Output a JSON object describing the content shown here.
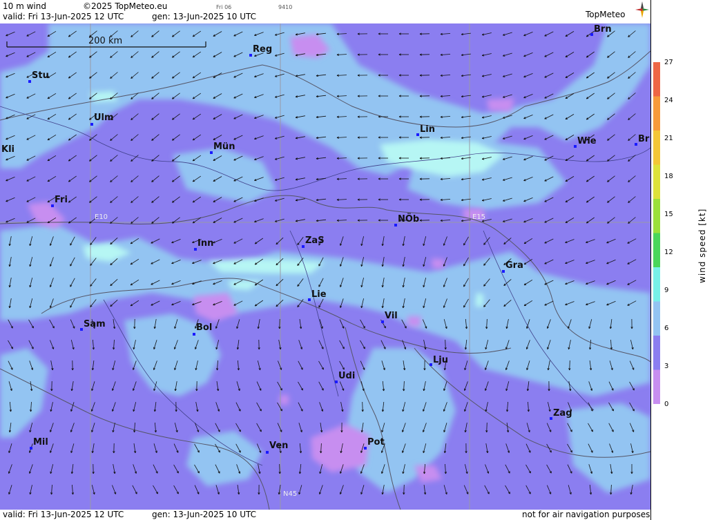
{
  "header": {
    "title": "10 m wind",
    "copyright": "©2025 TopMeteo.eu",
    "slot_day": "Fri 06",
    "slot_code": "9410",
    "valid": "valid:  Fri  13-Jun-2025  12 UTC",
    "generated": "gen: 13-Jun-2025 10 UTC",
    "logo": "TopMeteo"
  },
  "footer": {
    "valid": "valid:  Fri  13-Jun-2025  12 UTC",
    "generated": "gen: 13-Jun-2025 10 UTC",
    "disclaimer": "not for air navigation purposes"
  },
  "map": {
    "scale_label": "200 km",
    "grid_labels": [
      "E10",
      "E15",
      "N45"
    ],
    "cities": [
      "Brn",
      "Reg",
      "Stu",
      "Ulm",
      "Lin",
      "Kli",
      "Mün",
      "Wie",
      "Br",
      "Fri",
      "NÖb",
      "E10",
      "Inn",
      "ZaS",
      "Gra",
      "Lie",
      "Vil",
      "Sam",
      "Bol",
      "Lju",
      "Udi",
      "Zag",
      "Mil",
      "Ven",
      "Pot"
    ]
  },
  "colorbar": {
    "label": "wind speed  [kt]",
    "ticks": [
      "27",
      "24",
      "21",
      "18",
      "15",
      "12",
      "9",
      "6",
      "3",
      "0"
    ],
    "colors": [
      "#ee6644",
      "#f79a3a",
      "#f3c636",
      "#dde23a",
      "#9be03a",
      "#49d65a",
      "#77f0e8",
      "#93c4f2",
      "#8b7ef0",
      "#c78ef0"
    ]
  }
}
